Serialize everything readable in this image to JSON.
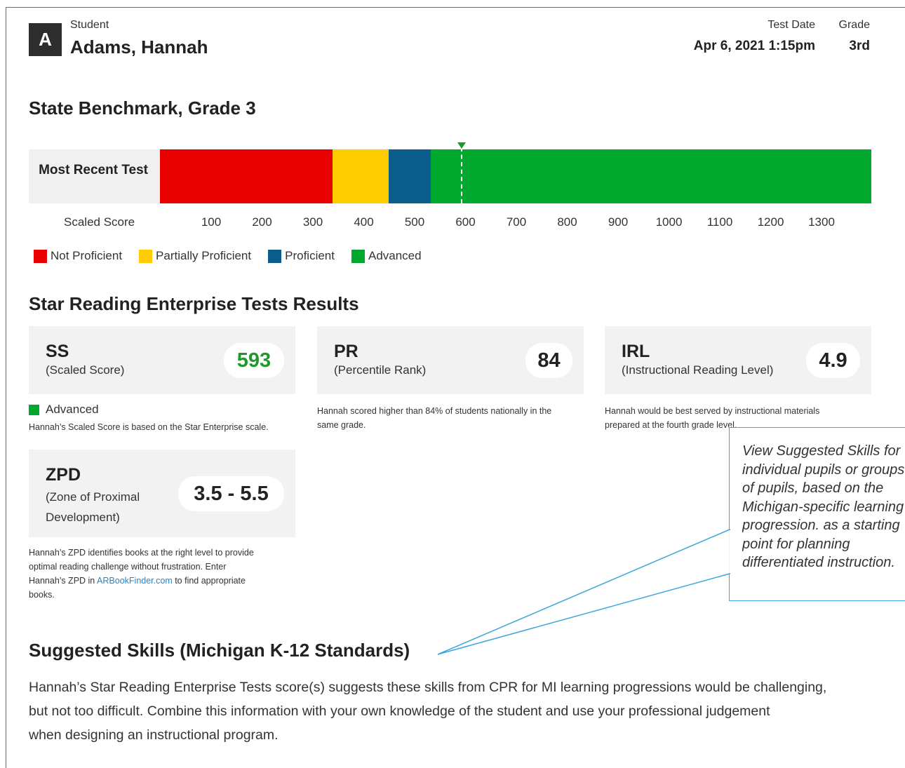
{
  "header": {
    "badge_letter": "A",
    "student_label": "Student",
    "student_name": "Adams, Hannah",
    "test_date_label": "Test Date",
    "test_date_value": "Apr 6, 2021 1:15pm",
    "grade_label": "Grade",
    "grade_value": "3rd"
  },
  "benchmark": {
    "title": "State Benchmark, Grade 3",
    "row_label": "Most Recent Test",
    "scale_label": "Scaled Score",
    "ticks": [
      "100",
      "200",
      "300",
      "400",
      "500",
      "600",
      "700",
      "800",
      "900",
      "1000",
      "1100",
      "1200",
      "1300"
    ],
    "student_score": 593,
    "segments": [
      {
        "name": "Not Proficient",
        "color": "#e80000"
      },
      {
        "name": "Partially Proficient",
        "color": "#ffcc00"
      },
      {
        "name": "Proficient",
        "color": "#0b5e8c"
      },
      {
        "name": "Advanced",
        "color": "#00a82d"
      }
    ],
    "marker_color": "#1e9a2a"
  },
  "results": {
    "title": "Star Reading Enterprise Tests Results",
    "ss": {
      "abbr": "SS",
      "full": "(Scaled Score)",
      "value": "593",
      "value_color": "#1e9a2a",
      "level": "Advanced",
      "note": "Hannah’s Scaled Score is based on the Star Enterprise scale."
    },
    "pr": {
      "abbr": "PR",
      "full": "(Percentile Rank)",
      "value": "84",
      "note_line1": "Hannah scored higher than 84% of students nationally in the",
      "note_line2": "same grade."
    },
    "irl": {
      "abbr": "IRL",
      "full": "(Instructional Reading Level)",
      "value": "4.9",
      "note_line1": "Hannah would be best served by instructional materials",
      "note_line2": "prepared at the fourth grade level."
    },
    "zpd": {
      "abbr": "ZPD",
      "full_line1": "(Zone of Proximal",
      "full_line2": "Development)",
      "value": "3.5 - 5.5",
      "note_line1": "Hannah’s ZPD identifies books at the right level to provide",
      "note_line2": "optimal reading challenge without frustration. Enter",
      "note_line3_pre": "Hannah’s ZPD in ",
      "note_link": "ARBookFinder.com",
      "note_line3_post": " to find appropriate",
      "note_line4": "books."
    }
  },
  "skills": {
    "title": "Suggested Skills (Michigan K-12 Standards)",
    "line1": "Hannah’s Star Reading Enterprise Tests score(s) suggests these skills from CPR for MI learning progressions would be challenging,",
    "line2": "but not too difficult. Combine this information with your own knowledge of the student and use your professional judgement",
    "line3": "when designing an instructional program."
  },
  "callout": {
    "line1": "View Suggested Skills for",
    "line2": "individual pupils or groups",
    "line3": "of pupils, based on the",
    "line4": "Michigan-specific learning",
    "line5": "progression. as a starting",
    "line6": "point for planning",
    "line7": "differentiated instruction.",
    "border_color": "#3ea6dc"
  }
}
